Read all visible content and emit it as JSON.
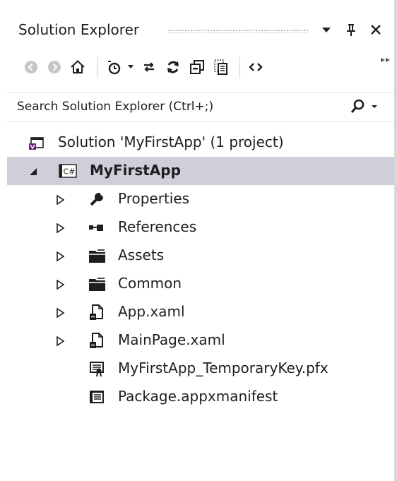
{
  "window": {
    "title": "Solution Explorer"
  },
  "title_buttons": [
    "dropdown-icon",
    "pin-icon",
    "close-icon"
  ],
  "toolbar": {
    "items": [
      "back-icon",
      "forward-icon",
      "home-icon",
      "pending-changes-filter-icon",
      "sync-with-active-document-icon",
      "refresh-icon",
      "collapse-all-icon",
      "show-all-files-icon",
      "view-code-icon"
    ]
  },
  "search": {
    "placeholder": "Search Solution Explorer (Ctrl+;)",
    "value": ""
  },
  "tree": {
    "solution": {
      "label": "Solution 'MyFirstApp' (1 project)",
      "icon": "solution-icon"
    },
    "project": {
      "label": "MyFirstApp",
      "icon": "csharp-project-icon",
      "icon_text": "C#",
      "expanded": true,
      "selected": true
    },
    "items": [
      {
        "label": "Properties",
        "icon": "wrench-icon",
        "expandable": true
      },
      {
        "label": "References",
        "icon": "references-icon",
        "expandable": true
      },
      {
        "label": "Assets",
        "icon": "folder-icon",
        "expandable": true
      },
      {
        "label": "Common",
        "icon": "folder-icon",
        "expandable": true
      },
      {
        "label": "App.xaml",
        "icon": "xaml-file-icon",
        "expandable": true
      },
      {
        "label": "MainPage.xaml",
        "icon": "xaml-file-icon",
        "expandable": true
      },
      {
        "label": "MyFirstApp_TemporaryKey.pfx",
        "icon": "certificate-icon",
        "expandable": false
      },
      {
        "label": "Package.appxmanifest",
        "icon": "manifest-icon",
        "expandable": false
      }
    ]
  },
  "colors": {
    "selection": "#cfcfda",
    "text": "#1e1e1e",
    "solution_icon_accent": "#68217a",
    "disabled_icon": "#c6c6c6"
  }
}
